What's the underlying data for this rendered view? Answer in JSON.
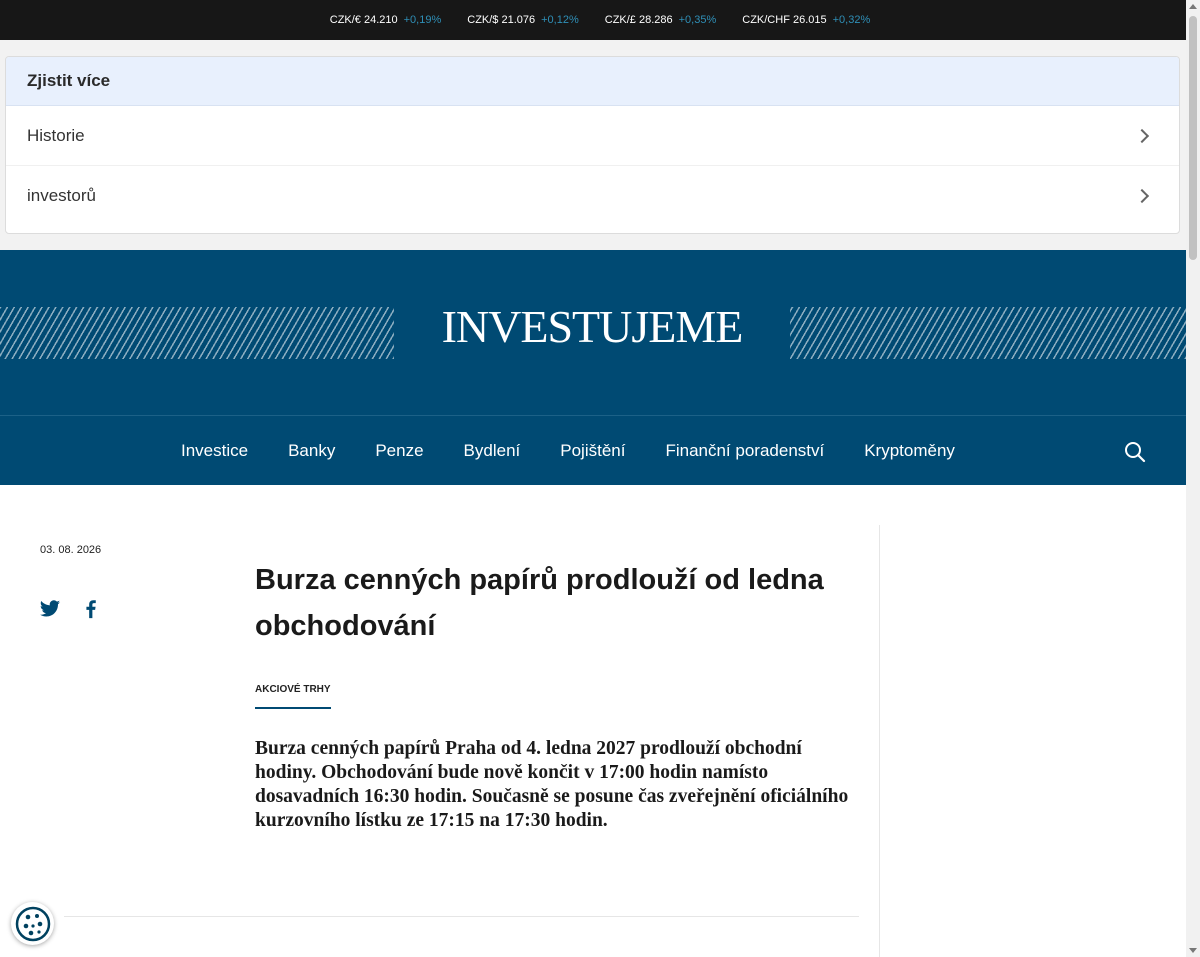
{
  "ticker": [
    {
      "pair": "CZK/€ 24.210",
      "change": "+0,19%"
    },
    {
      "pair": "CZK/$ 21.076",
      "change": "+0,12%"
    },
    {
      "pair": "CZK/£ 28.286",
      "change": "+0,35%"
    },
    {
      "pair": "CZK/CHF 26.015",
      "change": "+0,32%"
    }
  ],
  "more": {
    "heading": "Zjistit více",
    "items": [
      "Historie",
      "investorů"
    ]
  },
  "brand": {
    "logo": "INVESTUJEME"
  },
  "nav": {
    "items": [
      "Investice",
      "Banky",
      "Penze",
      "Bydlení",
      "Pojištění",
      "Finanční poradenství",
      "Kryptoměny"
    ],
    "search_icon": "search-icon"
  },
  "article": {
    "date": "03. 08. 2026",
    "title": "Burza cenných papírů prodlouží od ledna obchodování",
    "tag": "AKCIOVÉ TRHY",
    "perex": "Burza cenných papírů Praha od 4. ledna 2027 prodlouží obchodní hodiny. Obchodování bude nově končit v 17:00 hodin namísto dosavadních 16:30 hodin. Současně se posune čas zveřejnění oficiálního kurzovního lístku ze 17:15 na 17:30 hodin."
  },
  "share": {
    "twitter_icon": "twitter-icon",
    "facebook_icon": "facebook-icon"
  },
  "cookie": {
    "icon": "cookie-icon"
  },
  "colors": {
    "brand": "#004a73",
    "ticker_bg": "#171717",
    "ticker_change": "#2f8fb7",
    "more_head_bg": "#e8f0fd"
  }
}
